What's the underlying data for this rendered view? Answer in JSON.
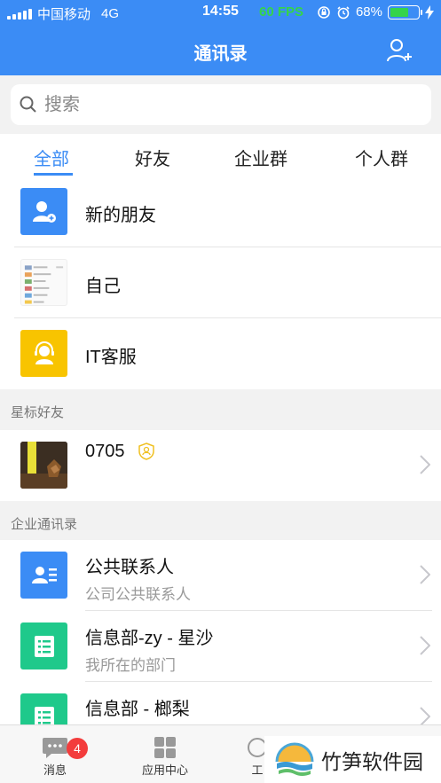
{
  "status_bar": {
    "carrier": "中国移动",
    "network": "4G",
    "time": "14:55",
    "fps": "60 FPS",
    "battery": "68%",
    "battery_level": 0.68
  },
  "nav": {
    "title": "通讯录"
  },
  "search": {
    "placeholder": "搜索"
  },
  "tabs": [
    {
      "label": "全部",
      "active": true
    },
    {
      "label": "好友",
      "active": false
    },
    {
      "label": "企业群",
      "active": false
    },
    {
      "label": "个人群",
      "active": false
    }
  ],
  "top_rows": [
    {
      "title": "新的朋友",
      "icon": "add-friend-icon",
      "color": "#3b8cf5"
    },
    {
      "title": "自己",
      "icon": "self-avatar"
    },
    {
      "title": "IT客服",
      "icon": "customer-service-icon",
      "color": "#f8c400"
    }
  ],
  "starred": {
    "header": "星标好友",
    "items": [
      {
        "title": "0705",
        "badge_icon": "shield-user-icon"
      }
    ]
  },
  "enterprise": {
    "header": "企业通讯录",
    "items": [
      {
        "title": "公共联系人",
        "subtitle": "公司公共联系人",
        "icon": "contact-card-icon",
        "color": "#3b8cf5"
      },
      {
        "title": "信息部-zy - 星沙",
        "subtitle": "我所在的部门",
        "icon": "department-list-icon",
        "color": "#1fc98b"
      },
      {
        "title": "信息部 - 榔梨",
        "subtitle": "",
        "icon": "department-list-icon",
        "color": "#1fc98b"
      }
    ]
  },
  "tabbar": {
    "items": [
      {
        "label": "消息",
        "icon": "chat-bubble-icon",
        "badge": "4"
      },
      {
        "label": "应用中心",
        "icon": "apps-grid-icon"
      },
      {
        "label": "工",
        "icon": "work-icon"
      }
    ]
  },
  "watermark": {
    "text": "竹笋软件园"
  },
  "colors": {
    "primary": "#3b8cf5",
    "green": "#1fc98b",
    "yellow": "#f8c400",
    "badge": "#f33c3c"
  }
}
